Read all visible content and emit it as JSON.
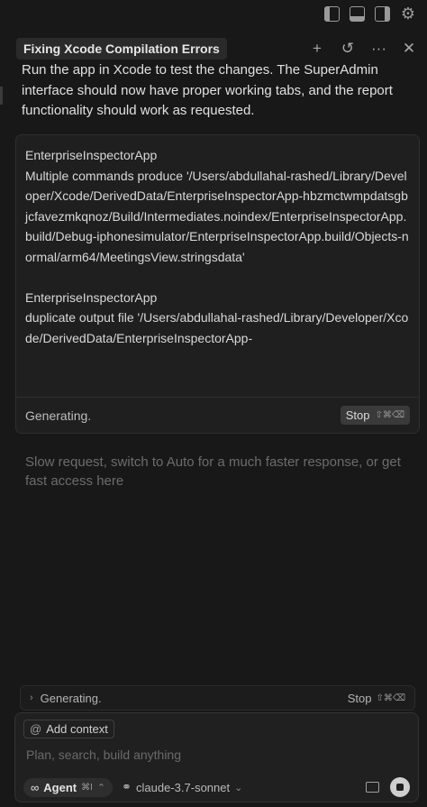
{
  "topbar": {
    "icons": [
      "toggle-left-panel-icon",
      "toggle-bottom-panel-icon",
      "toggle-right-panel-icon",
      "settings-gear-icon"
    ]
  },
  "chat": {
    "title": "Fixing Xcode Compilation Errors",
    "actions": {
      "new_chat": "+",
      "history": "↺",
      "more": "···",
      "close": "✕"
    }
  },
  "message": {
    "intro": "Run the app in Xcode to test the changes. The SuperAdmin interface should now have proper working tabs, and the report functionality should work as requested."
  },
  "output": {
    "blocks": [
      {
        "app": "EnterpriseInspectorApp",
        "text": "Multiple commands produce '/Users/abdullahal-rashed/Library/Developer/Xcode/DerivedData/EnterpriseInspectorApp-hbzmctwmpdatsgbjcfavezmkqnoz/Build/Intermediates.noindex/EnterpriseInspectorApp.build/Debug-iphonesimulator/EnterpriseInspectorApp.build/Objects-normal/arm64/MeetingsView.stringsdata'"
      },
      {
        "app": "EnterpriseInspectorApp",
        "text": "duplicate output file '/Users/abdullahal-rashed/Library/Developer/Xcode/DerivedData/EnterpriseInspectorApp-"
      }
    ],
    "status": "Generating.",
    "stop_label": "Stop",
    "stop_shortcut": "⇧⌘⌫"
  },
  "notice": {
    "slow_request": "Slow request, switch to Auto for a much faster response, or get fast access here"
  },
  "status_bar": {
    "label": "Generating.",
    "stop_label": "Stop",
    "stop_shortcut": "⇧⌘⌫"
  },
  "composer": {
    "add_context": "Add context",
    "placeholder": "Plan, search, build anything",
    "mode_label": "Agent",
    "mode_shortcut": "⌘I",
    "model": "claude-3.7-sonnet"
  }
}
